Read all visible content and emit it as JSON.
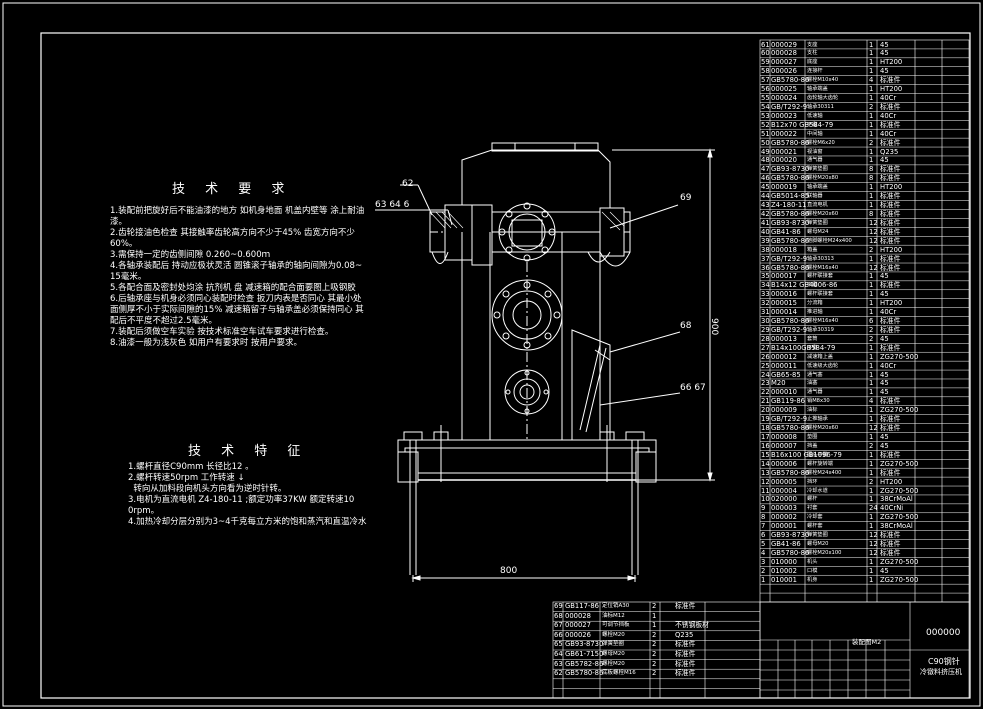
{
  "title_block": {
    "drawing_no": "000000",
    "name_line1": "C90钢针",
    "name_line2": "冷镦料挤压机",
    "label": "装配图M2"
  },
  "callouts": [
    "62",
    "63 64 6",
    "69",
    "68",
    "66 67"
  ],
  "dims": [
    "800",
    "900"
  ],
  "requirements": {
    "title": "技 术 要 求",
    "lines": [
      "1.装配前把旋好后不能油漆的地方 如机身地面 机盖内壁等 涂上耐油",
      "漆。",
      "2.齿轮接油色检查 其接触率齿轮高方向不少于45% 齿宽方向不少",
      "60%。",
      "3.需保持一定的齿侧间隙 0.260~0.600ｍ",
      "4.各轴承装配后 持动应极状灵活 圆锥滚子轴承的轴向间隙为0.08~",
      "15毫米。",
      "5.各配合面及密封处均涂 抗剂机 盘 减速箱的配合面要图上吸钢胶",
      "",
      "6.后轴承座与机身必须同心装配时检查 扳刀内表是否同心 其最小处",
      "面侧厚不小于实际间隙的15% 减速箱留子与轴承盖必须保持同心 其",
      "配后不平度不超过2.5毫米。",
      "7.装配后须做空车实验 按技术标准空车试车要求进行检查。",
      "8.油漆一般为浅灰色 如用户有要求时 按用户要求。"
    ]
  },
  "features": {
    "title": "技 术 特 征",
    "lines": [
      "1.螺杆直径C90mm 长径比12 。",
      "2.螺杆转速50rpm 工作转速 ↓",
      "  转向从加料段向机头方向看为逆时针转。",
      "3.电机为直流电机 Z4-180-11 ;额定功率37KW 额定转速10",
      "0rpm。",
      "4.加热冷却分层分别为3~4千克每立方米的饱和蒸汽和直温冷水"
    ]
  },
  "bom": [
    [
      "61",
      "000029",
      "支座",
      "1",
      "45"
    ],
    [
      "60",
      "000028",
      "支柱",
      "1",
      "45"
    ],
    [
      "59",
      "000027",
      "底座",
      "1",
      "HT200"
    ],
    [
      "58",
      "000026",
      "连接杆",
      "1",
      "45"
    ],
    [
      "57",
      "GB5780-86",
      "螺栓M10x40",
      "4",
      "标准件"
    ],
    [
      "56",
      "000025",
      "轴承端盖",
      "1",
      "HT200"
    ],
    [
      "55",
      "000024",
      "齿轮轴大齿轮",
      "1",
      "40Cr"
    ],
    [
      "54",
      "GB/T292-9",
      "轴承30311",
      "2",
      "标准件"
    ],
    [
      "53",
      "000023",
      "低速轴",
      "1",
      "40Cr"
    ],
    [
      "52",
      "B12x70 GB584-79",
      "平键",
      "1",
      "标准件"
    ],
    [
      "51",
      "000022",
      "中间轴",
      "1",
      "40Cr"
    ],
    [
      "50",
      "GB5780-86",
      "螺栓M6x20",
      "2",
      "标准件"
    ],
    [
      "49",
      "000021",
      "视油窗",
      "1",
      "Q235"
    ],
    [
      "48",
      "000020",
      "通气器",
      "1",
      "45"
    ],
    [
      "47",
      "GB93-8730",
      "弹簧垫圈",
      "8",
      "标准件"
    ],
    [
      "46",
      "GB5780-86",
      "螺栓M20x80",
      "8",
      "标准件"
    ],
    [
      "45",
      "000019",
      "轴承端盖",
      "1",
      "HT200"
    ],
    [
      "44",
      "GB5014-85",
      "联轴器",
      "1",
      "标准件"
    ],
    [
      "43",
      "Z4-180-11",
      "直流电机",
      "1",
      "标准件"
    ],
    [
      "42",
      "GB5780-86",
      "螺栓M20x60",
      "8",
      "标准件"
    ],
    [
      "41",
      "GB93-8730",
      "弹簧垫圈",
      "12",
      "标准件"
    ],
    [
      "40",
      "GB41-86",
      "螺母M24",
      "12",
      "标准件"
    ],
    [
      "39",
      "GB5780-86",
      "地脚螺栓M24x400",
      "12",
      "标准件"
    ],
    [
      "38",
      "000018",
      "箱盖",
      "2",
      "HT200"
    ],
    [
      "37",
      "GB/T292-9",
      "轴承30313",
      "1",
      "标准件"
    ],
    [
      "36",
      "GB5780-86",
      "螺栓M16x40",
      "12",
      "标准件"
    ],
    [
      "35",
      "000017",
      "螺杆联接套",
      "1",
      "45"
    ],
    [
      "34",
      "B14x12 GB4006-86",
      "平键",
      "1",
      "标准件"
    ],
    [
      "33",
      "000016",
      "螺杆联接套",
      "1",
      "45"
    ],
    [
      "32",
      "000015",
      "分流箱",
      "1",
      "HT200"
    ],
    [
      "31",
      "000014",
      "推进轴",
      "1",
      "40Cr"
    ],
    [
      "30",
      "GB5780-86",
      "螺栓M16x40",
      "6",
      "标准件"
    ],
    [
      "29",
      "GB/T292-9",
      "轴承30319",
      "2",
      "标准件"
    ],
    [
      "28",
      "000013",
      "套筒",
      "2",
      "45"
    ],
    [
      "27",
      "B14x100GB584-79",
      "平键",
      "1",
      "标准件"
    ],
    [
      "26",
      "000012",
      "减速箱上盖",
      "1",
      "ZG270-500"
    ],
    [
      "25",
      "000011",
      "低速级大齿轮",
      "1",
      "40Cr"
    ],
    [
      "24",
      "GB65-85",
      "通气塞",
      "1",
      "45"
    ],
    [
      "23",
      "M20",
      "油塞",
      "1",
      "45"
    ],
    [
      "22",
      "000010",
      "通气器",
      "1",
      "45"
    ],
    [
      "21",
      "GB119-86",
      "销M8x30",
      "4",
      "标准件"
    ],
    [
      "20",
      "000009",
      "油标",
      "1",
      "ZG270-500"
    ],
    [
      "19",
      "GB/T292-9",
      "止推轴承",
      "1",
      "标准件"
    ],
    [
      "18",
      "GB5780-86",
      "螺栓M20x60",
      "12",
      "标准件"
    ],
    [
      "17",
      "000008",
      "垫圈",
      "1",
      "45"
    ],
    [
      "16",
      "000007",
      "挡盖",
      "2",
      "45"
    ],
    [
      "15",
      "B16x100 GB1096-79",
      "圆头平键",
      "1",
      "标准件"
    ],
    [
      "14",
      "000006",
      "螺杆旋转端",
      "1",
      "ZG270-500"
    ],
    [
      "13",
      "GB5780-86",
      "螺栓M24x400",
      "1",
      "标准件"
    ],
    [
      "12",
      "000005",
      "挡环",
      "2",
      "HT200"
    ],
    [
      "11",
      "000004",
      "冷却水道",
      "1",
      "ZG270-500"
    ],
    [
      "10",
      "020000",
      "螺杆",
      "1",
      "38CrMoAl"
    ],
    [
      "9",
      "000003",
      "衬套",
      "24",
      "40CrNi"
    ],
    [
      "8",
      "000002",
      "冷却套",
      "1",
      "ZG270-500"
    ],
    [
      "7",
      "000001",
      "螺杆套",
      "1",
      "38CrMoAl"
    ],
    [
      "6",
      "GB93-8730",
      "弹簧垫圈",
      "12",
      "标准件"
    ],
    [
      "5",
      "GB41-86",
      "螺母M20",
      "12",
      "标准件"
    ],
    [
      "4",
      "GB5780-86",
      "螺栓M20x100",
      "12",
      "标准件"
    ],
    [
      "3",
      "010000",
      "机头",
      "1",
      "ZG270-500"
    ],
    [
      "2",
      "010002",
      "口模",
      "1",
      "45"
    ],
    [
      "1",
      "010001",
      "机身",
      "1",
      "ZG270-500"
    ]
  ],
  "bom2": [
    [
      "69",
      "GB117-86",
      "定位销A30",
      "2",
      "标准件"
    ],
    [
      "68",
      "000028",
      "油标M12",
      "1",
      ""
    ],
    [
      "67",
      "000027",
      "可调节挡板",
      "1",
      "不锈钢板材"
    ],
    [
      "66",
      "000026",
      "螺栓M20",
      "2",
      "Q235"
    ],
    [
      "65",
      "GB93-8730",
      "弹簧垫圈",
      "2",
      "标准件"
    ],
    [
      "64",
      "GB61-7150",
      "螺母M20",
      "2",
      "标准件"
    ],
    [
      "63",
      "GB5782-86",
      "螺栓M20",
      "2",
      "标准件"
    ],
    [
      "62",
      "GB5780-86",
      "底板螺栓M16",
      "2",
      "标准件"
    ]
  ]
}
